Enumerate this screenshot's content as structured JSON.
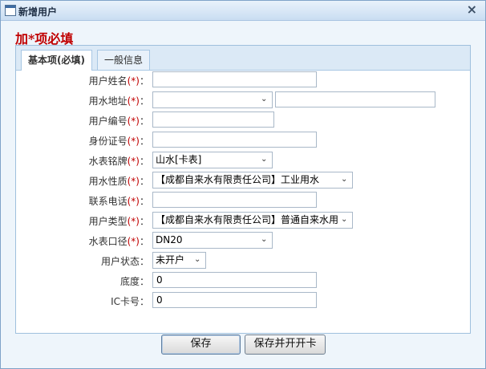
{
  "window": {
    "title": "新增用户",
    "close_label": "×",
    "required_hint": "加*项必填"
  },
  "tabs": [
    {
      "label": "基本项(必填)",
      "active": true
    },
    {
      "label": "一般信息",
      "active": false
    }
  ],
  "form": {
    "rows": [
      {
        "label": "用户姓名",
        "required": "(*)",
        "type": "input",
        "value": ""
      },
      {
        "label": "用水地址",
        "required": "(*)",
        "type": "select+input",
        "value": "",
        "extra_value": ""
      },
      {
        "label": "用户编号",
        "required": "(*)",
        "type": "input",
        "value": ""
      },
      {
        "label": "身份证号",
        "required": "(*)",
        "type": "input",
        "value": ""
      },
      {
        "label": "水表铭牌",
        "required": "(*)",
        "type": "select",
        "value": "山水[卡表]"
      },
      {
        "label": "用水性质",
        "required": "(*)",
        "type": "select",
        "value": "【成都自来水有限责任公司】工业用水"
      },
      {
        "label": "联系电话",
        "required": "(*)",
        "type": "input",
        "value": ""
      },
      {
        "label": "用户类型",
        "required": "(*)",
        "type": "select",
        "value": "【成都自来水有限责任公司】普通自来水用"
      },
      {
        "label": "水表口径",
        "required": "(*)",
        "type": "select",
        "value": "DN20"
      },
      {
        "label": "用户状态",
        "required": "",
        "type": "select",
        "value": "未开户"
      },
      {
        "label": "底度",
        "required": "",
        "type": "input",
        "value": "0"
      },
      {
        "label": "IC卡号",
        "required": "",
        "type": "input",
        "value": "0"
      }
    ],
    "colon": "："
  },
  "buttons": {
    "save": "保存",
    "save_and_open_card": "保存并开开卡"
  },
  "icons": {
    "window": "window-icon",
    "close": "close-icon",
    "dropdown": "chevron-down-icon"
  },
  "colors": {
    "required": "#c00000",
    "border": "#9fc0dd",
    "tab_bg": "#dbe9f6"
  }
}
